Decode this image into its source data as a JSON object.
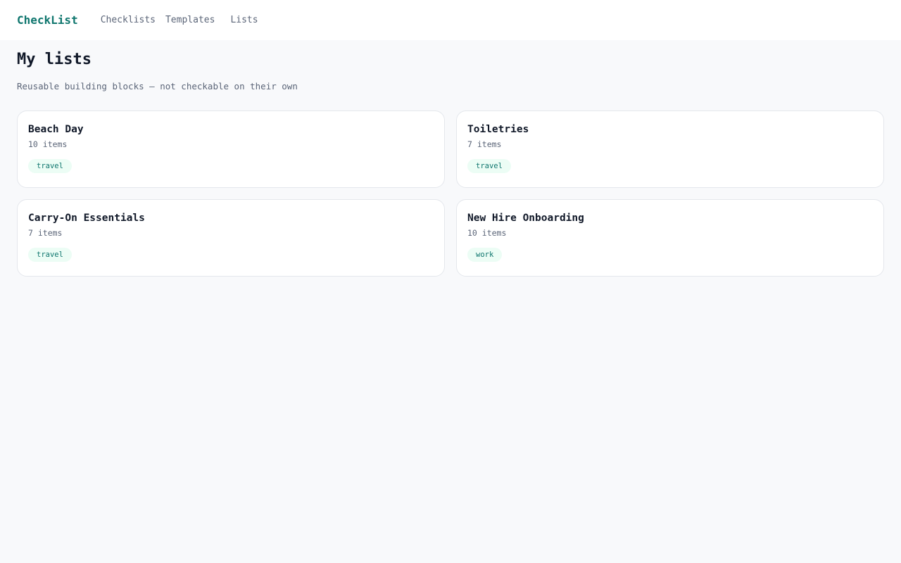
{
  "app": {
    "brand": "CheckList",
    "accent_color": "#0f766e"
  },
  "nav": {
    "items": [
      {
        "label": "Checklists"
      },
      {
        "label": "Templates"
      },
      {
        "label": "Lists"
      }
    ]
  },
  "page": {
    "title": "My lists",
    "subtitle": "Reusable building blocks — not checkable on their own"
  },
  "lists": [
    {
      "name": "Beach Day",
      "count": "10 items",
      "tag": "travel"
    },
    {
      "name": "Toiletries",
      "count": "7 items",
      "tag": "travel"
    },
    {
      "name": "Carry-On Essentials",
      "count": "7 items",
      "tag": "travel"
    },
    {
      "name": "New Hire Onboarding",
      "count": "10 items",
      "tag": "work"
    }
  ]
}
